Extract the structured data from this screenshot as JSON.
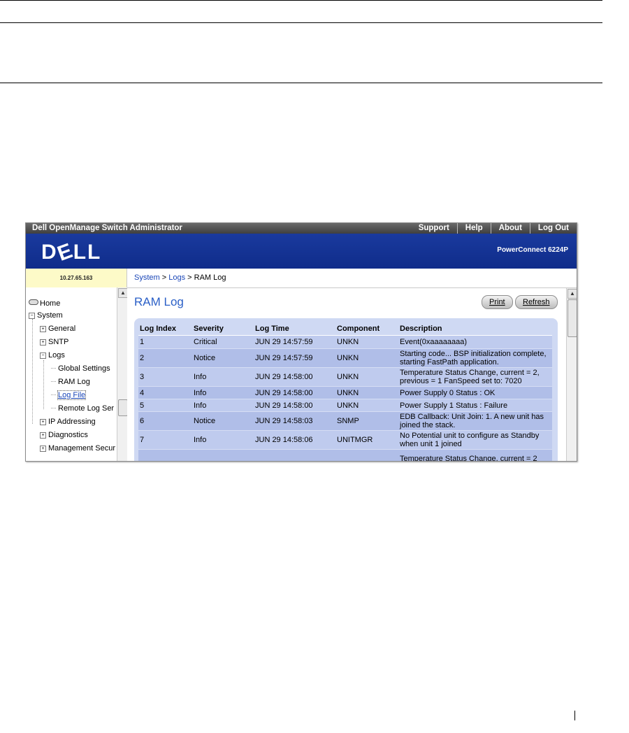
{
  "app": {
    "title": "Dell OpenManage Switch Administrator",
    "nav": [
      "Support",
      "Help",
      "About",
      "Log Out"
    ],
    "brand_logo": "DELL",
    "product": "PowerConnect 6224P",
    "ip": "10.27.65.163"
  },
  "breadcrumb": {
    "parts": [
      "System",
      "Logs",
      "RAM Log"
    ],
    "sep": " > "
  },
  "tree": {
    "home": "Home",
    "system": "System",
    "general": "General",
    "sntp": "SNTP",
    "logs": "Logs",
    "global_settings": "Global Settings",
    "ram_log": "RAM Log",
    "log_file": "Log File",
    "remote_log": "Remote Log Ser",
    "ip_addressing": "IP Addressing",
    "diagnostics": "Diagnostics",
    "management_security": "Management Secur",
    "expander_plus": "+",
    "expander_minus": "−"
  },
  "page": {
    "title": "RAM Log",
    "print_label": "Print",
    "refresh_label": "Refresh"
  },
  "table": {
    "headers": [
      "Log Index",
      "Severity",
      "Log Time",
      "Component",
      "Description"
    ],
    "rows": [
      [
        "1",
        "Critical",
        "JUN 29 14:57:59",
        "UNKN",
        "Event(0xaaaaaaaa)"
      ],
      [
        "2",
        "Notice",
        "JUN 29 14:57:59",
        "UNKN",
        "Starting code... BSP initialization complete, starting FastPath application."
      ],
      [
        "3",
        "Info",
        "JUN 29 14:58:00",
        "UNKN",
        "Temperature Status Change, current = 2, previous = 1 FanSpeed set to: 7020"
      ],
      [
        "4",
        "Info",
        "JUN 29 14:58:00",
        "UNKN",
        "Power Supply 0 Status : OK"
      ],
      [
        "5",
        "Info",
        "JUN 29 14:58:00",
        "UNKN",
        "Power Supply 1 Status : Failure"
      ],
      [
        "6",
        "Notice",
        "JUN 29 14:58:03",
        "SNMP",
        "EDB Callback: Unit Join: 1. A new unit has joined the stack."
      ],
      [
        "7",
        "Info",
        "JUN 29 14:58:06",
        "UNITMGR",
        "No Potential unit to configure as Standby when unit 1 joined"
      ],
      [
        "",
        "",
        "",
        "",
        "Temperature Status Change, current = 2"
      ]
    ]
  },
  "colors": {
    "brand_blue": "#1a3a9e",
    "link_blue": "#1a46b8",
    "title_blue": "#2a5fc7",
    "table_bg": "#cfd9f3"
  }
}
